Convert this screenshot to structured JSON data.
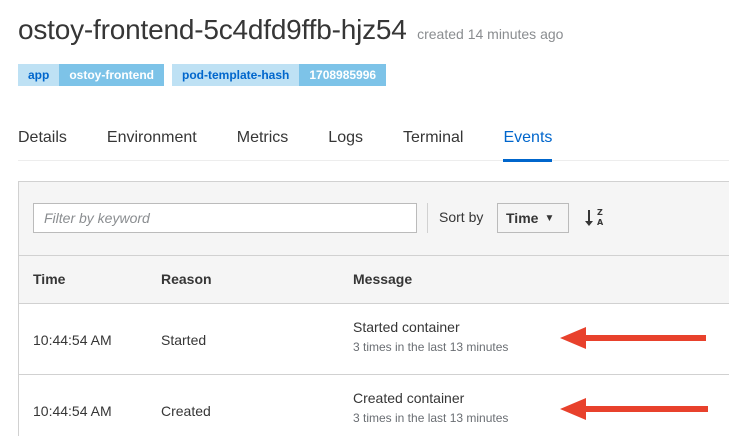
{
  "header": {
    "pod_name": "ostoy-frontend-5c4dfd9ffb-hjz54",
    "created": "created 14 minutes ago"
  },
  "labels": [
    {
      "key": "app",
      "value": "ostoy-frontend"
    },
    {
      "key": "pod-template-hash",
      "value": "1708985996"
    }
  ],
  "tabs": [
    {
      "label": "Details"
    },
    {
      "label": "Environment"
    },
    {
      "label": "Metrics"
    },
    {
      "label": "Logs"
    },
    {
      "label": "Terminal"
    },
    {
      "label": "Events",
      "active": true
    }
  ],
  "toolbar": {
    "filter_placeholder": "Filter by keyword",
    "sort_by_label": "Sort by",
    "sort_value": "Time",
    "sort_icon": "sort-alpha-asc-icon"
  },
  "table": {
    "columns": [
      "Time",
      "Reason",
      "Message"
    ],
    "rows": [
      {
        "time": "10:44:54 AM",
        "reason": "Started",
        "message": "Started container",
        "detail": "3 times in the last 13 minutes"
      },
      {
        "time": "10:44:54 AM",
        "reason": "Created",
        "message": "Created container",
        "detail": "3 times in the last 13 minutes"
      }
    ]
  },
  "annotations": {
    "arrow_color": "#e8412c"
  },
  "colors": {
    "accent": "#0066cc",
    "label_key_bg": "#bee1f4",
    "label_value_bg": "#7dc3e8"
  }
}
